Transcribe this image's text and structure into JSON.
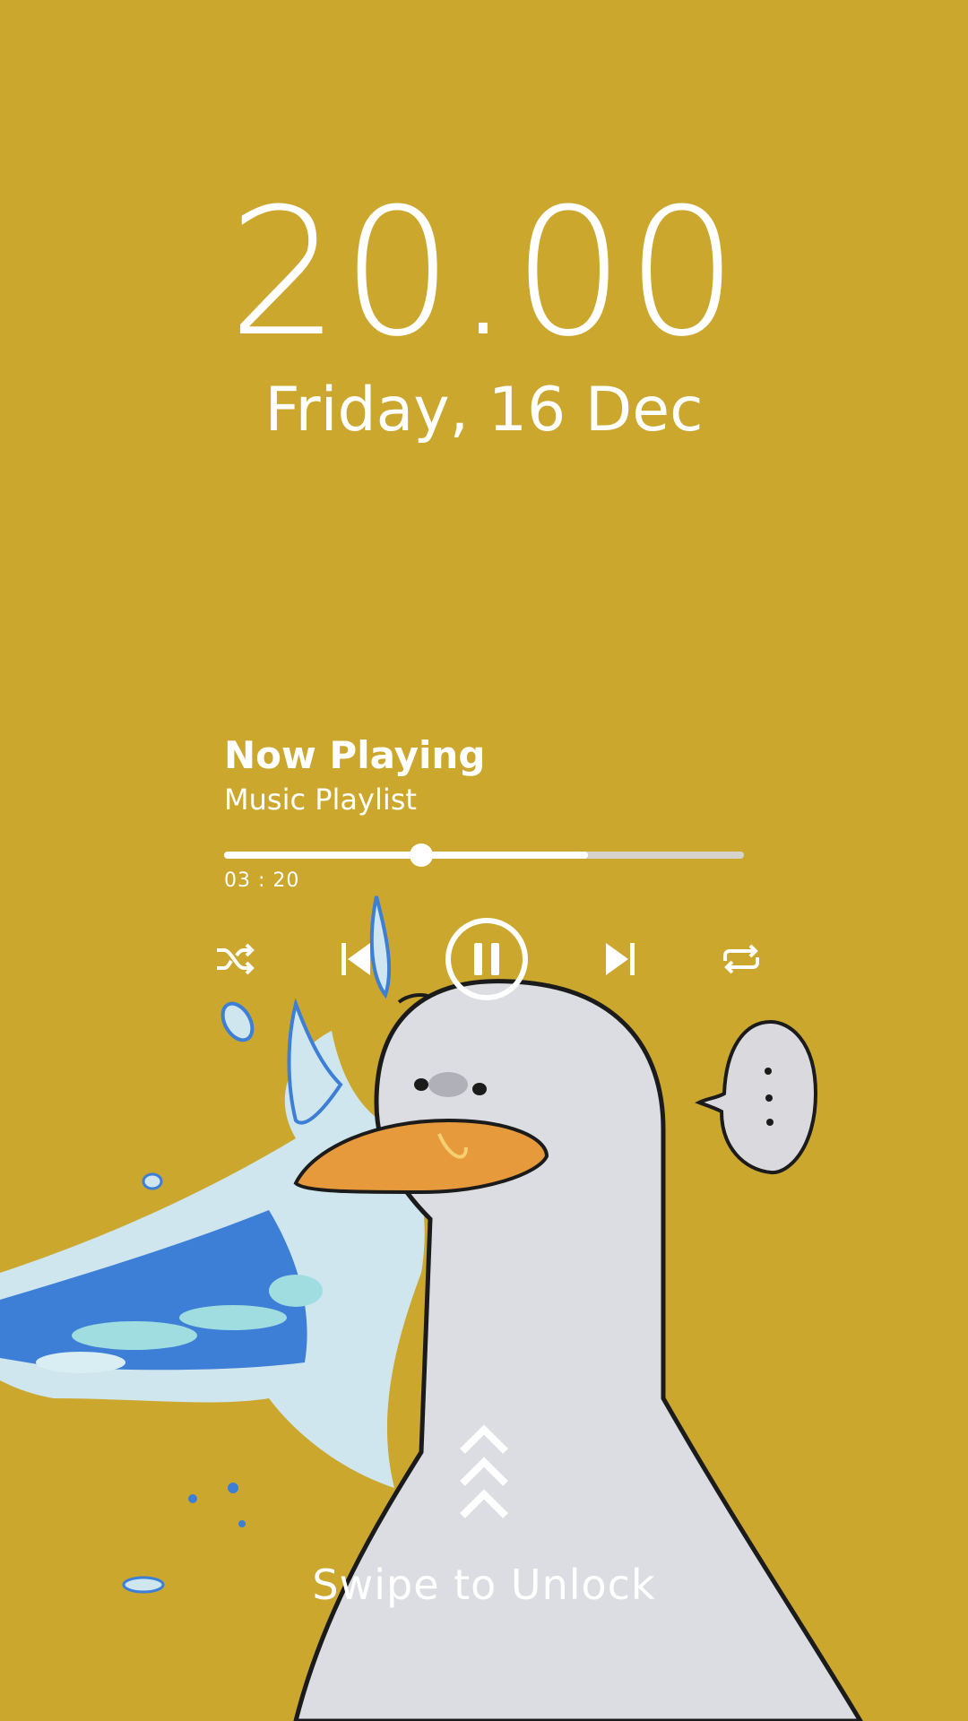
{
  "theme": {
    "background": "#cba72e",
    "foreground": "#ffffff",
    "track": "#d6d3cd"
  },
  "lockscreen": {
    "time": "20.00",
    "date": "Friday, 16 Dec"
  },
  "player": {
    "title": "Now Playing",
    "subtitle": "Music Playlist",
    "elapsed": "03 : 20",
    "progress_fraction": 0.38,
    "buffered_fraction": 0.7,
    "controls": [
      {
        "name": "shuffle",
        "icon": "shuffle-icon"
      },
      {
        "name": "previous",
        "icon": "skip-previous-icon"
      },
      {
        "name": "pause",
        "icon": "pause-circle-icon"
      },
      {
        "name": "next",
        "icon": "skip-next-icon"
      },
      {
        "name": "repeat",
        "icon": "repeat-icon"
      }
    ]
  },
  "unlock": {
    "label": "Swipe to Unlock",
    "icon": "chevrons-up-icon"
  },
  "wallpaper": {
    "subject": "duck-illustration"
  }
}
